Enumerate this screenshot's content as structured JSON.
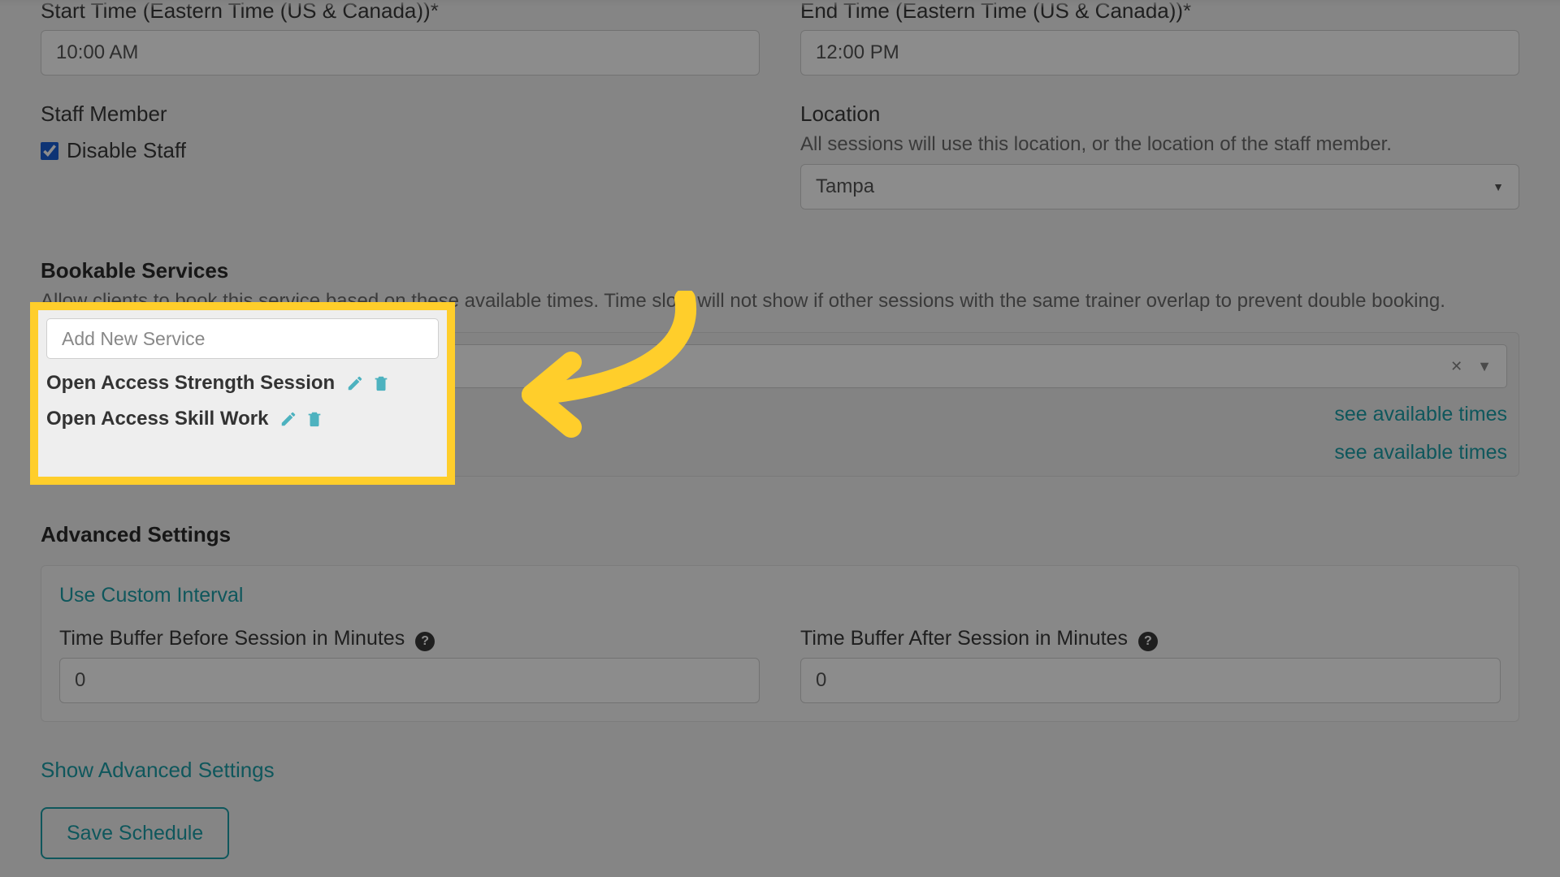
{
  "time": {
    "start_label": "Start Time (Eastern Time (US & Canada))*",
    "start_value": "10:00 AM",
    "end_label": "End Time (Eastern Time (US & Canada))*",
    "end_value": "12:00 PM"
  },
  "staff": {
    "label": "Staff Member",
    "disable_label": "Disable Staff",
    "disabled": true
  },
  "location": {
    "label": "Location",
    "hint": "All sessions will use this location, or the location of the staff member.",
    "value": "Tampa"
  },
  "bookable": {
    "title": "Bookable Services",
    "subtitle": "Allow clients to book this service based on these available times. Time slots will not show if other sessions with the same trainer overlap to prevent double booking.",
    "add_placeholder": "Add New Service",
    "see_times_label": "see available times",
    "services": [
      {
        "name": "Open Access Strength Session"
      },
      {
        "name": "Open Access Skill Work"
      }
    ]
  },
  "advanced": {
    "title": "Advanced Settings",
    "custom_interval_label": "Use Custom Interval",
    "buffer_before_label": "Time Buffer Before Session in Minutes",
    "buffer_before_value": "0",
    "buffer_after_label": "Time Buffer After Session in Minutes",
    "buffer_after_value": "0",
    "show_advanced_label": "Show Advanced Settings"
  },
  "actions": {
    "save_label": "Save Schedule"
  },
  "colors": {
    "teal": "#1c9fa8",
    "highlight_yellow": "#ffce2b"
  }
}
